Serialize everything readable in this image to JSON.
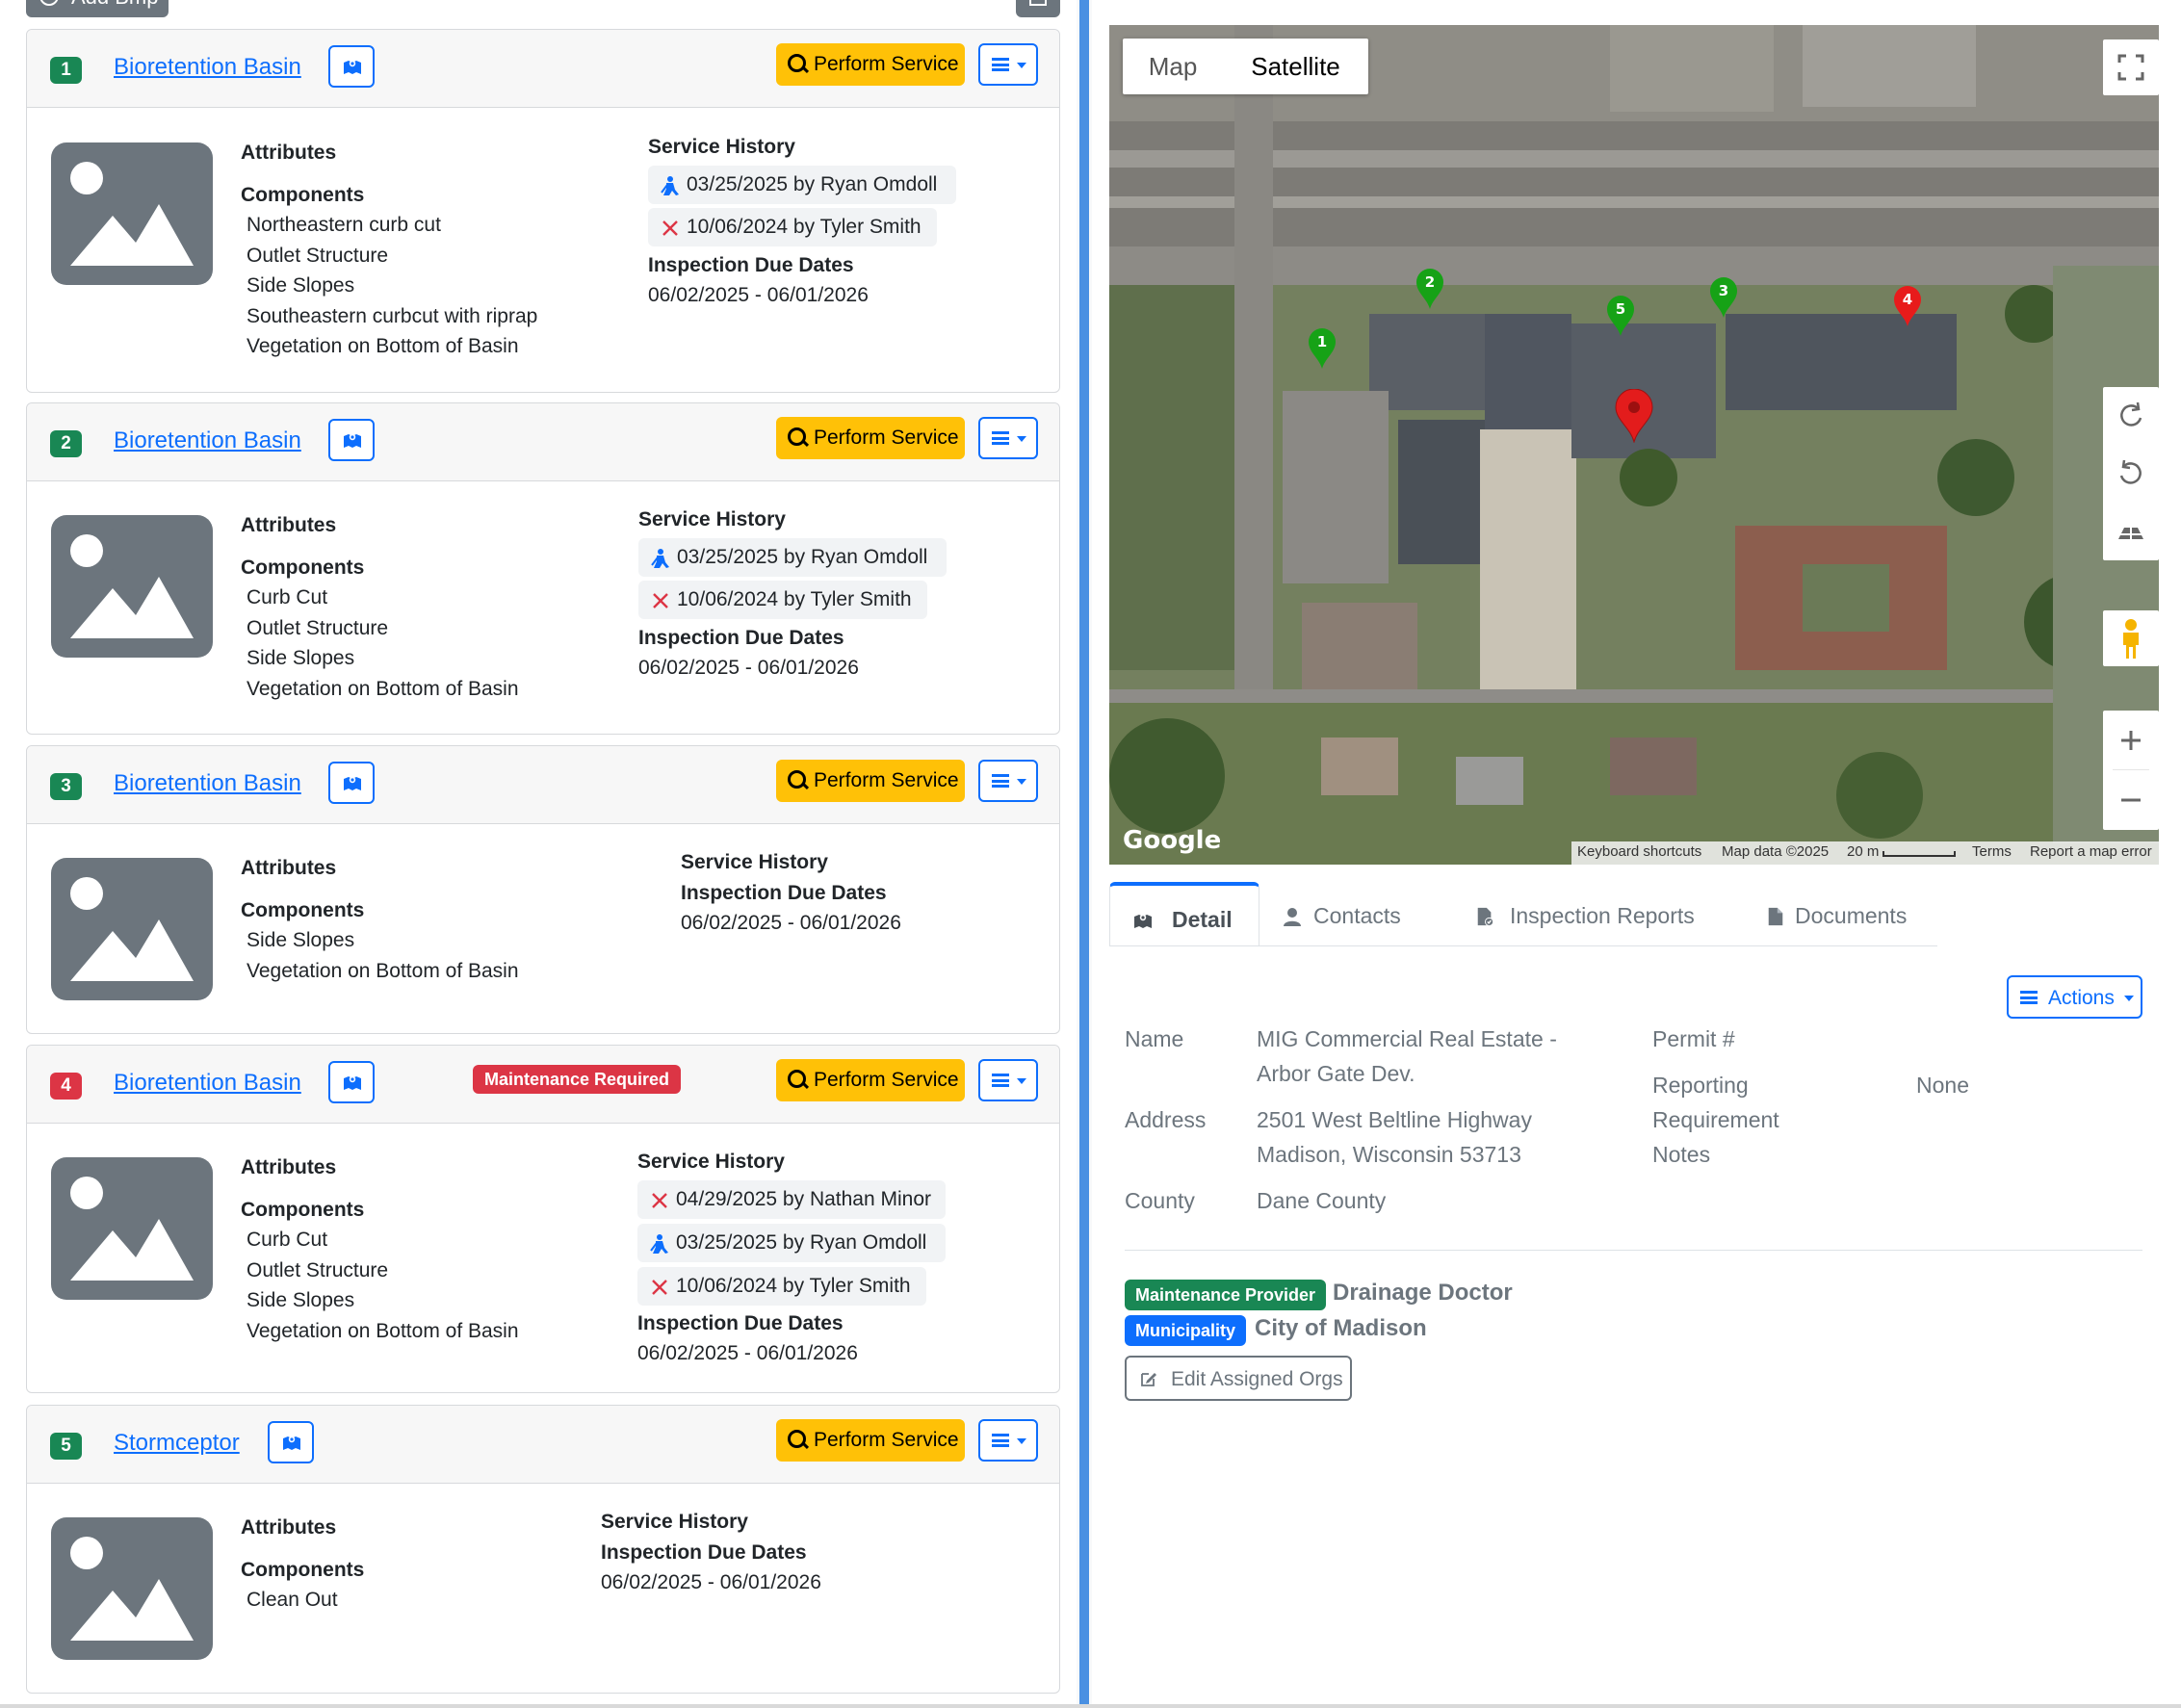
{
  "toolbar": {
    "add_label": "Add Bmp"
  },
  "bmps": [
    {
      "number": "1",
      "badge_color": "#198754",
      "title": "Bioretention Basin",
      "perform_label": "Perform Service",
      "attributes_label": "Attributes",
      "components_label": "Components",
      "components": [
        "Northeastern curb cut",
        "Outlet Structure",
        "Side Slopes",
        "Southeastern curbcut with riprap",
        "Vegetation on Bottom of Basin"
      ],
      "service_history_label": "Service History",
      "service_history": [
        "03/25/2025 by Ryan Omdoll",
        "10/06/2024 by Tyler Smith"
      ],
      "inspection_label": "Inspection Due Dates",
      "inspection_dates": "06/02/2025 - 06/01/2026"
    },
    {
      "number": "2",
      "badge_color": "#198754",
      "title": "Bioretention Basin",
      "perform_label": "Perform Service",
      "attributes_label": "Attributes",
      "components_label": "Components",
      "components": [
        "Curb Cut",
        "Outlet Structure",
        "Side Slopes",
        "Vegetation on Bottom of Basin"
      ],
      "service_history_label": "Service History",
      "service_history": [
        "03/25/2025 by Ryan Omdoll",
        "10/06/2024 by Tyler Smith"
      ],
      "inspection_label": "Inspection Due Dates",
      "inspection_dates": "06/02/2025 - 06/01/2026"
    },
    {
      "number": "3",
      "badge_color": "#198754",
      "title": "Bioretention Basin",
      "perform_label": "Perform Service",
      "attributes_label": "Attributes",
      "components_label": "Components",
      "components": [
        "Side Slopes",
        "Vegetation on Bottom of Basin"
      ],
      "service_history_label": "Service History",
      "inspection_label": "Inspection Due Dates",
      "inspection_dates": "06/02/2025 - 06/01/2026"
    },
    {
      "number": "4",
      "badge_color": "#dc3545",
      "title": "Bioretention Basin",
      "status_badge": "Maintenance Required",
      "perform_label": "Perform Service",
      "attributes_label": "Attributes",
      "components_label": "Components",
      "components": [
        "Curb Cut",
        "Outlet Structure",
        "Side Slopes",
        "Vegetation on Bottom of Basin"
      ],
      "service_history_label": "Service History",
      "service_history": [
        "04/29/2025 by Nathan Minor",
        "03/25/2025 by Ryan Omdoll",
        "10/06/2024 by Tyler Smith"
      ],
      "inspection_label": "Inspection Due Dates",
      "inspection_dates": "06/02/2025 - 06/01/2026"
    },
    {
      "number": "5",
      "badge_color": "#198754",
      "title": "Stormceptor",
      "perform_label": "Perform Service",
      "attributes_label": "Attributes",
      "components_label": "Components",
      "components": [
        "Clean Out"
      ],
      "service_history_label": "Service History",
      "inspection_label": "Inspection Due Dates",
      "inspection_dates": "06/02/2025 - 06/01/2026"
    }
  ],
  "map": {
    "type_map": "Map",
    "type_satellite": "Satellite",
    "google_logo": "Google",
    "attribution": [
      "Keyboard shortcuts",
      "Map data ©2025",
      "20 m",
      "Terms",
      "Report a map error"
    ],
    "markers": [
      "1",
      "2",
      "3",
      "4",
      "5"
    ]
  },
  "tabs": [
    "Detail",
    "Contacts",
    "Inspection Reports",
    "Documents"
  ],
  "actions_label": "Actions",
  "detail": {
    "name_label": "Name",
    "name_lines": [
      "MIG Commercial Real Estate -",
      "Arbor Gate Dev."
    ],
    "address_label": "Address",
    "address_lines": [
      "2501 West Beltline Highway",
      "Madison, Wisconsin 53713"
    ],
    "county_label": "County",
    "county": "Dane County",
    "permit_label": "Permit #",
    "reporting_label_lines": [
      "Reporting",
      "Requirement",
      "Notes"
    ],
    "reporting_value": "None"
  },
  "orgs": [
    {
      "role": "Maintenance Provider",
      "role_color": "#198754",
      "name": "Drainage Doctor"
    },
    {
      "role": "Municipality",
      "role_color": "#0d6efd",
      "name": "City of Madison"
    }
  ],
  "edit_orgs_label": "Edit Assigned Orgs"
}
